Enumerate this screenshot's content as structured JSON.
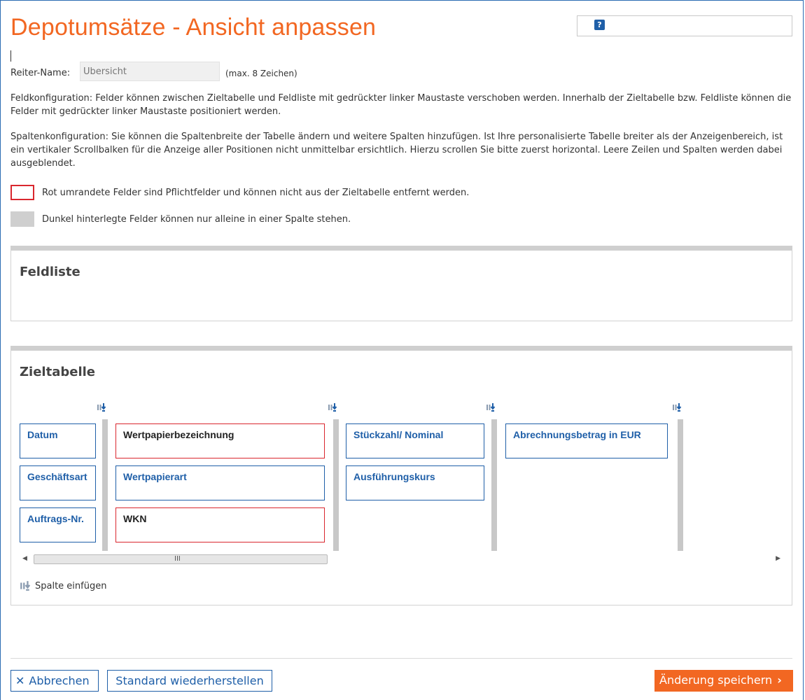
{
  "page": {
    "title": "Depotumsätze - Ansicht anpassen",
    "help_icon_glyph": "?"
  },
  "reiter": {
    "label": "Reiter-Name:",
    "value": "Übersicht",
    "hint": "(max. 8 Zeichen)"
  },
  "info": {
    "feldkonfiguration": "Feldkonfiguration: Felder können zwischen Zieltabelle und Feldliste mit gedrückter linker Maustaste verschoben werden. Innerhalb der Zieltabelle bzw. Feldliste können die Felder mit gedrückter linker Maustaste positioniert werden.",
    "spaltenkonfiguration": "Spaltenkonfiguration: Sie können die Spaltenbreite der Tabelle ändern und weitere Spalten hinzufügen. Ist Ihre personalisierte Tabelle breiter als der Anzeigenbereich, ist ein vertikaler Scrollbalken für die Anzeige aller Positionen nicht unmittelbar ersichtlich. Hierzu scrollen Sie bitte zuerst horizontal. Leere Zeilen und Spalten werden dabei ausgeblendet."
  },
  "legend": {
    "red_text": "Rot umrandete Felder sind Pflichtfelder und können nicht aus der Zieltabelle entfernt werden.",
    "grey_text": "Dunkel hinterlegte Felder können nur alleine in einer Spalte stehen."
  },
  "feldliste": {
    "title": "Feldliste"
  },
  "zieltabelle": {
    "title": "Zieltabelle",
    "fields": {
      "datum": "Datum",
      "geschaeftsart": "Geschäftsart",
      "auftrags_nr": "Auftrags-Nr.",
      "wertpapierbezeichnung": "Wertpapierbezeichnung",
      "wertpapierart": "Wertpapierart",
      "wkn": "WKN",
      "stueckzahl": "Stückzahl/ Nominal",
      "ausfuehrungskurs": "Ausführungskurs",
      "abrechnungsbetrag": "Abrechnungsbetrag in EUR"
    },
    "scroll_left_glyph": "◀",
    "scroll_right_glyph": "▶",
    "scroll_grip": "III",
    "add_column_label": "Spalte einfügen"
  },
  "colors": {
    "accent": "#f26722",
    "link_blue": "#1f5fa8",
    "required_red": "#d9272e",
    "grey": "#cfcfcf"
  },
  "icons": {
    "help": "help-icon",
    "insert_column": "insert-column-icon"
  },
  "actions": {
    "cancel_label": "Abbrechen",
    "cancel_glyph": "✕",
    "restore_label": "Standard wiederherstellen",
    "save_label": "Änderung speichern",
    "save_glyph": "›"
  }
}
